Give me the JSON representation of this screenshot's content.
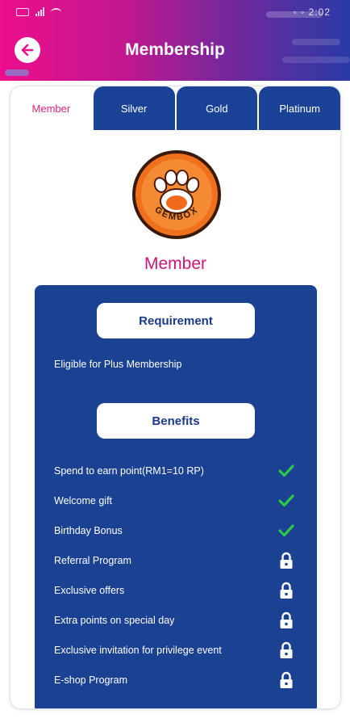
{
  "status_bar": {
    "right_text": "◦ ◦ 2:02"
  },
  "header": {
    "title": "Membership"
  },
  "tabs": [
    {
      "label": "Member",
      "active": true
    },
    {
      "label": "Silver",
      "active": false
    },
    {
      "label": "Gold",
      "active": false
    },
    {
      "label": "Platinum",
      "active": false
    }
  ],
  "logo": {
    "text": "GEMBOX",
    "icon": "paw-icon"
  },
  "tier": {
    "name": "Member"
  },
  "requirement": {
    "heading": "Requirement",
    "text": "Eligible for Plus Membership"
  },
  "benefits": {
    "heading": "Benefits",
    "items": [
      {
        "label": "Spend to earn point(RM1=10 RP)",
        "status": "check"
      },
      {
        "label": "Welcome gift",
        "status": "check"
      },
      {
        "label": "Birthday Bonus",
        "status": "check"
      },
      {
        "label": "Referral Program",
        "status": "lock"
      },
      {
        "label": "Exclusive offers",
        "status": "lock"
      },
      {
        "label": "Extra points on special day",
        "status": "lock"
      },
      {
        "label": "Exclusive invitation for privilege event",
        "status": "lock"
      },
      {
        "label": "E-shop Program",
        "status": "lock"
      }
    ]
  },
  "colors": {
    "accent_pink": "#d0157a",
    "panel_blue": "#1b4192",
    "check_green": "#2cc84a"
  }
}
